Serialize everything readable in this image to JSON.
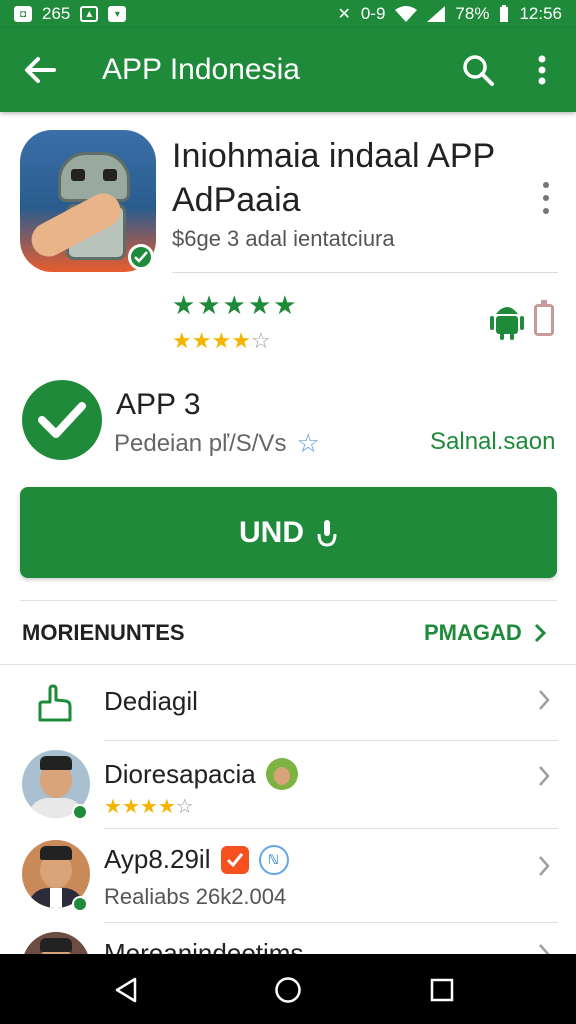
{
  "status_bar": {
    "left_text": "265",
    "signal_text": "0-9",
    "battery": "78%",
    "time": "12:56"
  },
  "app_bar": {
    "title": "APP Indonesia",
    "back_icon": "arrow-back-icon",
    "search_icon": "search-icon",
    "more_icon": "more-vert-icon"
  },
  "app": {
    "title": "Iniohmaia indaal APP AdPaaia",
    "subtitle": "$6ge 3 adal ientatciura",
    "green_stars": 5,
    "gold_rating": 3.5,
    "gold_max": 5
  },
  "install_row": {
    "title": "APP 3",
    "subtitle": "Pedeian pľ/S/Vs",
    "right_text": "Salnal.saon"
  },
  "primary_button": {
    "label": "UND"
  },
  "section": {
    "title": "MORIENUNTES",
    "action": "PMAGAD"
  },
  "list": [
    {
      "title": "Dediagil",
      "icon": "hand-pointer-icon"
    },
    {
      "title": "Dioresapacia",
      "rating": 4,
      "rating_max": 5
    },
    {
      "title": "Ayp8.29il",
      "subtitle": "Realiabs 26k2.004"
    },
    {
      "title": "Mereanindeetims"
    }
  ],
  "colors": {
    "primary": "#1e8a3a",
    "star_gold": "#f4b400",
    "accent_blue": "#5a9bd6"
  }
}
